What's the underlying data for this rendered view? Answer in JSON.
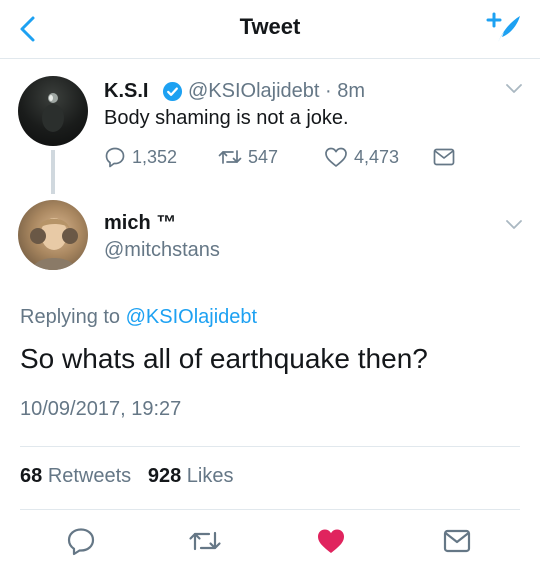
{
  "header": {
    "title": "Tweet"
  },
  "parent_tweet": {
    "name": "K.S.I",
    "handle_time": "@KSIOlajidebt · 8m",
    "text": "Body shaming is not a joke.",
    "replies": "1,352",
    "retweets": "547",
    "likes": "4,473"
  },
  "reply_tweet": {
    "name": "mich ™",
    "handle": "@mitchstans",
    "replying_prefix": "Replying to",
    "replying_to": "@KSIOlajidebt",
    "text": "So whats all of earthquake then?",
    "timestamp": "10/09/2017, 19:27",
    "retweets_count": "68",
    "retweets_label": "Retweets",
    "likes_count": "928",
    "likes_label": "Likes"
  },
  "colors": {
    "accent": "#1da1f2",
    "like": "#e0245e",
    "muted": "#657786",
    "text": "#14171a"
  }
}
